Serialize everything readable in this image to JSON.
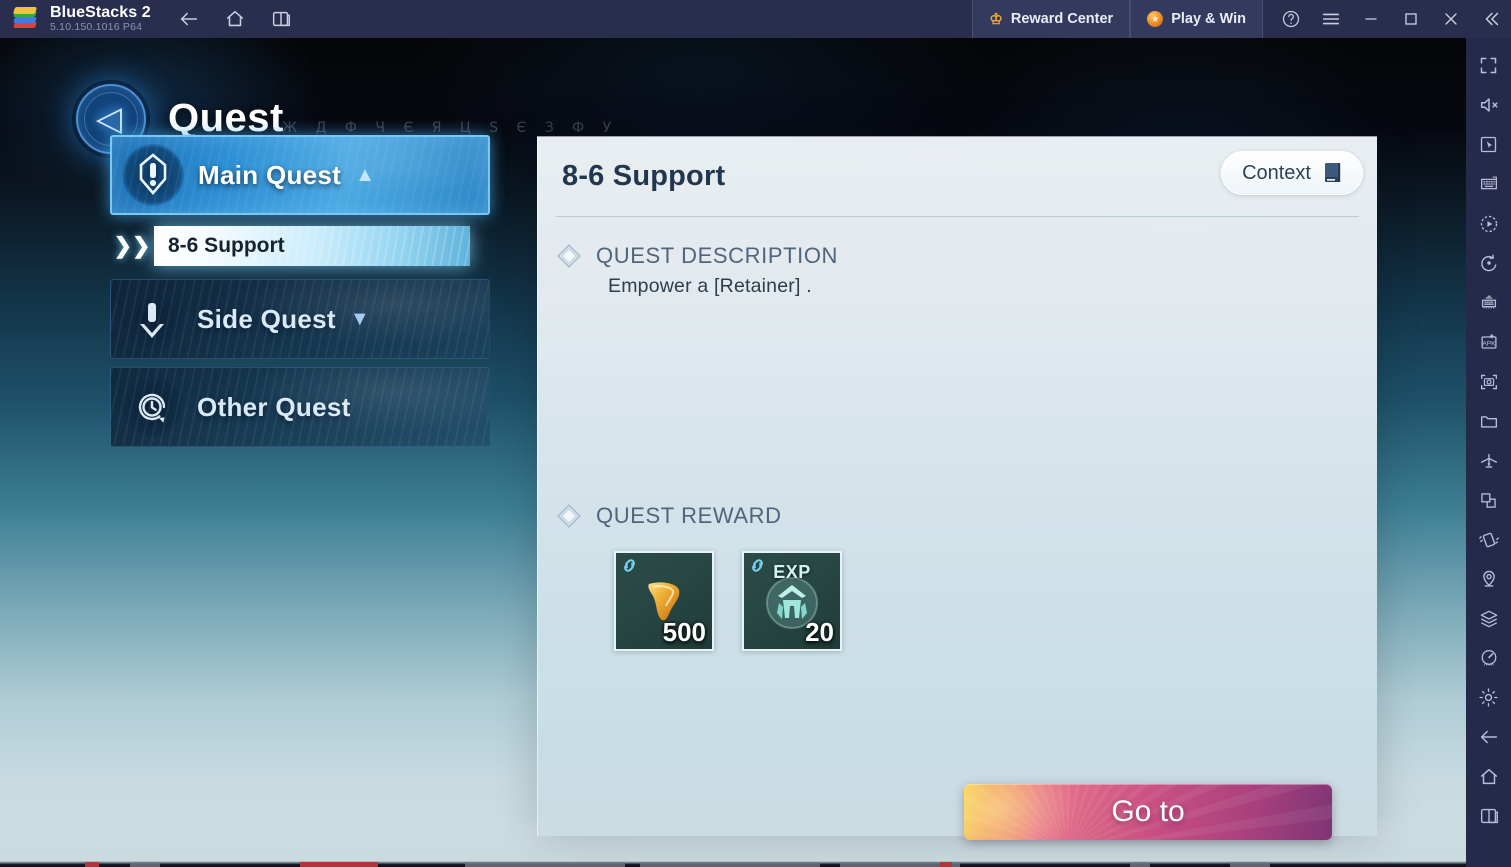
{
  "titlebar": {
    "app_name": "BlueStacks 2",
    "version": "5.10.150.1016  P64",
    "nav_icons": [
      {
        "name": "back-arrow-icon",
        "label": "Back"
      },
      {
        "name": "home-icon",
        "label": "Home"
      },
      {
        "name": "multi-instance-icon",
        "label": "Instances"
      }
    ],
    "reward_center": "Reward Center",
    "play_and_win": "Play & Win",
    "help": "?",
    "menu": "☰",
    "minimize": "—",
    "maximize": "□",
    "close": "✕",
    "collapse": "«"
  },
  "rail": {
    "icons": [
      "fullscreen-icon",
      "mute-icon",
      "cursor-icon",
      "keyboard-controls-icon",
      "macro-record-icon",
      "rotate-icon",
      "game-controls-icon",
      "install-apk-icon",
      "screenshot-icon",
      "media-folder-icon",
      "eco-mode-icon",
      "resize-icon",
      "shake-icon",
      "location-icon",
      "multi-instance-layers-icon",
      "performance-icon",
      "settings-gear-icon",
      "android-back-icon",
      "android-home-icon",
      "android-recents-icon"
    ]
  },
  "quest_screen": {
    "header": {
      "title": "Quest",
      "back_glyph": "◁",
      "runes": "Ж Д Ф Ч Є Я  Ц Ѕ Є З Ф У"
    },
    "categories": [
      {
        "id": "main-quest",
        "label": "Main Quest",
        "icon": "quest-exclaim-icon",
        "arrow": "▲",
        "state": "active",
        "expanded": true
      },
      {
        "id": "side-quest",
        "label": "Side Quest",
        "icon": "quest-down-arrow-icon",
        "arrow": "▼",
        "state": "inactive",
        "expanded": false
      },
      {
        "id": "other-quest",
        "label": "Other Quest",
        "icon": "clock-refresh-icon",
        "arrow": "",
        "state": "inactive",
        "expanded": false
      }
    ],
    "selected_subquest": {
      "label": "8-6 Support",
      "chevrons": "❯❯"
    },
    "detail": {
      "title": "8-6 Support",
      "context_button": {
        "label": "Context",
        "icon": "book-icon"
      },
      "description_section": {
        "heading": "QUEST DESCRIPTION",
        "bullet_icon": "diamond-bullet-icon",
        "text": "Empower a  [Retainer] ."
      },
      "reward_section": {
        "heading": "QUEST REWARD",
        "bullet_icon": "diamond-bullet-icon",
        "items": [
          {
            "name": "fang-currency-item",
            "qty": "500",
            "tag": "",
            "art": "golden-fang-icon",
            "badge": "link-icon"
          },
          {
            "name": "exp-item",
            "qty": "20",
            "tag": "EXP",
            "art": "exp-helmet-icon",
            "badge": "link-icon"
          }
        ]
      },
      "action_button": {
        "label": "Go to"
      }
    }
  },
  "colors": {
    "titlebar_bg": "#2a2e4e",
    "rail_bg": "#262a4a",
    "active_category": "#2d8fd4",
    "panel_bg": "#eef4f7",
    "panel_title": "#22364f",
    "goto_gradient_start": "#f5d24a",
    "goto_gradient_end": "#7e3574",
    "reward_tile_bg": "#2c4b48"
  }
}
